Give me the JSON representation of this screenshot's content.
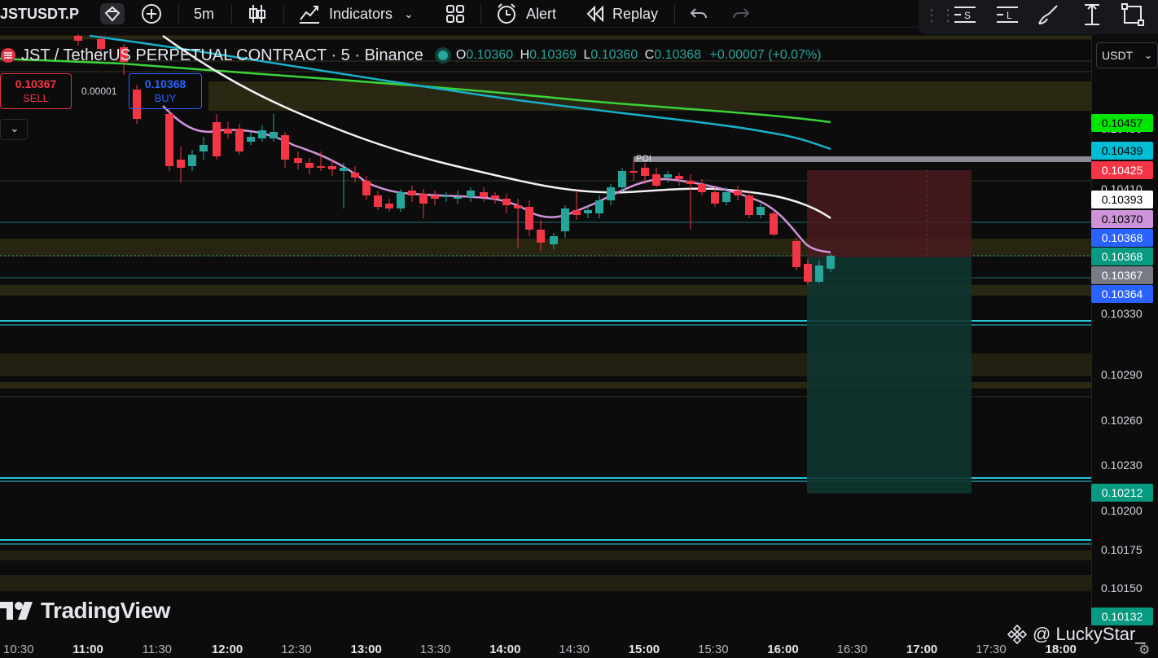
{
  "toolbar": {
    "symbol": "JSTUSDT.P",
    "interval": "5m",
    "indicators_label": "Indicators",
    "alert_label": "Alert",
    "replay_label": "Replay"
  },
  "legend": {
    "title": "JST / TetherUS PERPETUAL CONTRACT · 5 · Binance",
    "o_label": "O",
    "o_value": "0.10360",
    "h_label": "H",
    "h_value": "0.10369",
    "l_label": "L",
    "l_value": "0.10360",
    "c_label": "C",
    "c_value": "0.10368",
    "change": "+0.00007 (+0.07%)"
  },
  "trade": {
    "sell_price": "0.10367",
    "sell_label": "SELL",
    "spread": "0.00001",
    "buy_price": "0.10368",
    "buy_label": "BUY"
  },
  "currency": "USDT",
  "poi_label": "POI",
  "price_labels": [
    {
      "value": "0.10457",
      "bg": "#00e600",
      "fg": "#000000"
    },
    {
      "value": "0.10439",
      "bg": "#00bcd4",
      "fg": "#000000"
    },
    {
      "value": "0.10425",
      "bg": "#f23645",
      "fg": "#ffffff"
    },
    {
      "value": "0.10393",
      "bg": "#ffffff",
      "fg": "#000000"
    },
    {
      "value": "0.10370",
      "bg": "#ce93d8",
      "fg": "#000000"
    },
    {
      "value": "0.10368",
      "bg": "#2962ff",
      "fg": "#ffffff"
    },
    {
      "value": "0.10368",
      "bg": "#089981",
      "fg": "#ffffff"
    },
    {
      "value": "0.10367",
      "bg": "#787b86",
      "fg": "#ffffff"
    },
    {
      "value": "0.10364",
      "bg": "#2962ff",
      "fg": "#ffffff"
    },
    {
      "value": "0.10212",
      "bg": "#089981",
      "fg": "#ffffff"
    },
    {
      "value": "0.10132",
      "bg": "#089981",
      "fg": "#ffffff"
    }
  ],
  "price_ticks": [
    "0.10330",
    "0.10290",
    "0.10260",
    "0.10230",
    "0.10200",
    "0.10175",
    "0.10150",
    "0.10430",
    "0.10410"
  ],
  "time_ticks": [
    {
      "label": "10:30",
      "bold": false
    },
    {
      "label": "11:00",
      "bold": true
    },
    {
      "label": "11:30",
      "bold": false
    },
    {
      "label": "12:00",
      "bold": true
    },
    {
      "label": "12:30",
      "bold": false
    },
    {
      "label": "13:00",
      "bold": true
    },
    {
      "label": "13:30",
      "bold": false
    },
    {
      "label": "14:00",
      "bold": true
    },
    {
      "label": "14:30",
      "bold": false
    },
    {
      "label": "15:00",
      "bold": true
    },
    {
      "label": "15:30",
      "bold": false
    },
    {
      "label": "16:00",
      "bold": true
    },
    {
      "label": "16:30",
      "bold": false
    },
    {
      "label": "17:00",
      "bold": true
    },
    {
      "label": "17:30",
      "bold": false
    },
    {
      "label": "18:00",
      "bold": true
    }
  ],
  "branding": {
    "logo": "TradingView",
    "watermark": "@ LuckyStar_"
  },
  "colors": {
    "up": "#26a69a",
    "down": "#f23645",
    "zone": "#2d2a14",
    "level": "#26c6da"
  },
  "chart_data": {
    "type": "candlestick",
    "title": "JST / TetherUS PERPETUAL CONTRACT · 5 · Binance",
    "candles_close": [
      0.10365,
      0.1037,
      0.10382,
      0.10395,
      0.10405,
      0.1041,
      0.10407,
      0.10404,
      0.10393,
      0.10368
    ],
    "ema_values": {
      "green": 0.10457,
      "cyan": 0.10439,
      "white": 0.10393,
      "violet": 0.1037
    },
    "position": {
      "stop": 0.10425,
      "entry": 0.10368,
      "target": 0.10212
    }
  }
}
